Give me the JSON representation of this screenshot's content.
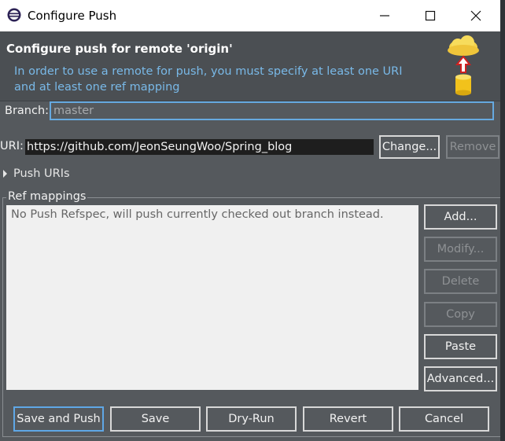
{
  "window": {
    "title": "Configure Push",
    "minimize_icon": "minimize-icon",
    "maximize_icon": "maximize-icon",
    "close_icon": "close-icon"
  },
  "header": {
    "title": "Configure push for remote 'origin'",
    "description": "In order to use a remote for push, you must specify at least one URI and at least one ref mapping",
    "icon": "cloud-push-icon"
  },
  "branch": {
    "label": "Branch:",
    "value": "master"
  },
  "uri": {
    "label": "URI:",
    "value": "https://github.com/JeonSeungWoo/Spring_blog",
    "change_label": "Change...",
    "remove_label": "Remove"
  },
  "push_uris": {
    "label": "Push URIs"
  },
  "ref_mappings": {
    "label": "Ref mappings",
    "empty_text": "No Push Refspec, will push currently checked out branch instead.",
    "buttons": {
      "add": "Add...",
      "modify": "Modify...",
      "delete": "Delete",
      "copy": "Copy",
      "paste": "Paste",
      "advanced": "Advanced..."
    }
  },
  "footer": {
    "save_and_push": "Save and Push",
    "save": "Save",
    "dry_run": "Dry-Run",
    "revert": "Revert",
    "cancel": "Cancel"
  },
  "colors": {
    "background": "#55595d",
    "header_bg": "#4b4f53",
    "description_text": "#79b9e8",
    "focus_border": "#5fa7e6"
  }
}
